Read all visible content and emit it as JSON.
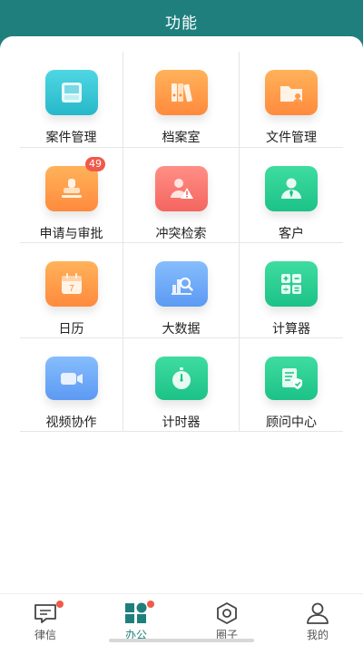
{
  "header": {
    "title": "功能"
  },
  "grid": {
    "items": [
      {
        "label": "案件管理",
        "icon": "inbox-tray-icon",
        "color": "#26b8c9"
      },
      {
        "label": "档案室",
        "icon": "binders-icon",
        "color": "#ff8a3d"
      },
      {
        "label": "文件管理",
        "icon": "folder-user-icon",
        "color": "#ff8a3d"
      },
      {
        "label": "申请与审批",
        "icon": "stamp-icon",
        "color": "#ff8a3d",
        "badge": "49"
      },
      {
        "label": "冲突检索",
        "icon": "user-warning-icon",
        "color": "#f4655f"
      },
      {
        "label": "客户",
        "icon": "person-tie-icon",
        "color": "#1cc287"
      },
      {
        "label": "日历",
        "icon": "calendar-icon",
        "color": "#ff8a3d",
        "calendar_day": "7"
      },
      {
        "label": "大数据",
        "icon": "data-search-icon",
        "color": "#5c9af3"
      },
      {
        "label": "计算器",
        "icon": "calculator-icon",
        "color": "#1cc287"
      },
      {
        "label": "视频协作",
        "icon": "video-camera-icon",
        "color": "#5c9af3"
      },
      {
        "label": "计时器",
        "icon": "stopwatch-icon",
        "color": "#1cc287"
      },
      {
        "label": "顾问中心",
        "icon": "document-shield-icon",
        "color": "#1cc287"
      }
    ]
  },
  "tabbar": {
    "tabs": [
      {
        "label": "律信",
        "icon": "chat-icon",
        "dot": true
      },
      {
        "label": "办公",
        "icon": "office-grid-icon",
        "dot": true,
        "active": true
      },
      {
        "label": "圈子",
        "icon": "hexagon-icon",
        "dot": false
      },
      {
        "label": "我的",
        "icon": "user-icon",
        "dot": false
      }
    ]
  },
  "colors": {
    "brand": "#1f7f7d",
    "badge": "#f05a4a"
  }
}
